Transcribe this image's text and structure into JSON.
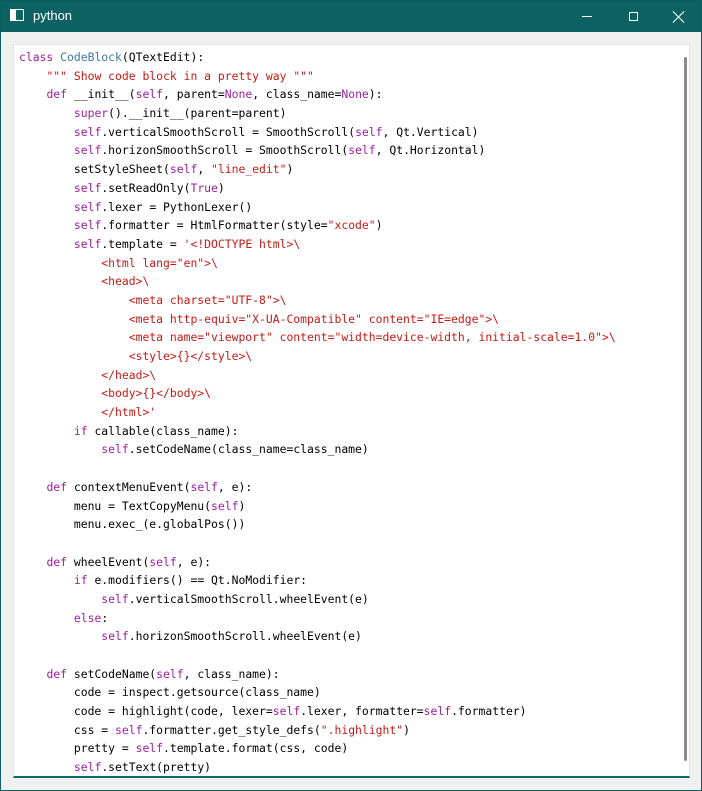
{
  "window": {
    "title": "python",
    "minimize_label": "minimize",
    "maximize_label": "maximize",
    "close_label": "close"
  },
  "colors": {
    "keyword": "#9c1fa0",
    "builtin": "#9c1fa0",
    "string": "#c41a16",
    "tag": "#c41a16",
    "classname": "#3c7a9e",
    "plain": "#000000",
    "titlebar": "#0c6262"
  },
  "code_lines": [
    [
      [
        "k",
        "class"
      ],
      [
        "p",
        " "
      ],
      [
        "c",
        "CodeBlock"
      ],
      [
        "p",
        "(QTextEdit):"
      ]
    ],
    [
      [
        "p",
        "    "
      ],
      [
        "s",
        "\"\"\" Show code block in a pretty way \"\"\""
      ]
    ],
    [
      [
        "p",
        "    "
      ],
      [
        "k",
        "def"
      ],
      [
        "p",
        " __init__("
      ],
      [
        "b",
        "self"
      ],
      [
        "p",
        ", parent="
      ],
      [
        "b",
        "None"
      ],
      [
        "p",
        ", class_name="
      ],
      [
        "b",
        "None"
      ],
      [
        "p",
        "):"
      ]
    ],
    [
      [
        "p",
        "        "
      ],
      [
        "b",
        "super"
      ],
      [
        "p",
        "().__init__(parent=parent)"
      ]
    ],
    [
      [
        "p",
        "        "
      ],
      [
        "b",
        "self"
      ],
      [
        "p",
        ".verticalSmoothScroll = SmoothScroll("
      ],
      [
        "b",
        "self"
      ],
      [
        "p",
        ", Qt.Vertical)"
      ]
    ],
    [
      [
        "p",
        "        "
      ],
      [
        "b",
        "self"
      ],
      [
        "p",
        ".horizonSmoothScroll = SmoothScroll("
      ],
      [
        "b",
        "self"
      ],
      [
        "p",
        ", Qt.Horizontal)"
      ]
    ],
    [
      [
        "p",
        "        setStyleSheet("
      ],
      [
        "b",
        "self"
      ],
      [
        "p",
        ", "
      ],
      [
        "s",
        "\"line_edit\""
      ],
      [
        "p",
        ")"
      ]
    ],
    [
      [
        "p",
        "        "
      ],
      [
        "b",
        "self"
      ],
      [
        "p",
        ".setReadOnly("
      ],
      [
        "b",
        "True"
      ],
      [
        "p",
        ")"
      ]
    ],
    [
      [
        "p",
        "        "
      ],
      [
        "b",
        "self"
      ],
      [
        "p",
        ".lexer = PythonLexer()"
      ]
    ],
    [
      [
        "p",
        "        "
      ],
      [
        "b",
        "self"
      ],
      [
        "p",
        ".formatter = HtmlFormatter(style="
      ],
      [
        "s",
        "\"xcode\""
      ],
      [
        "p",
        ")"
      ]
    ],
    [
      [
        "p",
        "        "
      ],
      [
        "b",
        "self"
      ],
      [
        "p",
        ".template = "
      ],
      [
        "s",
        "'<!DOCTYPE html>\\"
      ]
    ],
    [
      [
        "s",
        "            <html lang=\"en\">\\"
      ]
    ],
    [
      [
        "s",
        "            <head>\\"
      ]
    ],
    [
      [
        "s",
        "                <meta charset=\"UTF-8\">\\"
      ]
    ],
    [
      [
        "s",
        "                <meta http-equiv=\"X-UA-Compatible\" content=\"IE=edge\">\\"
      ]
    ],
    [
      [
        "s",
        "                <meta name=\"viewport\" content=\"width=device-width, initial-scale=1.0\">\\"
      ]
    ],
    [
      [
        "s",
        "                <style>{}</style>\\"
      ]
    ],
    [
      [
        "s",
        "            </head>\\"
      ]
    ],
    [
      [
        "s",
        "            <body>{}</body>\\"
      ]
    ],
    [
      [
        "s",
        "            </html>'"
      ]
    ],
    [
      [
        "p",
        "        "
      ],
      [
        "k",
        "if"
      ],
      [
        "p",
        " callable(class_name):"
      ]
    ],
    [
      [
        "p",
        "            "
      ],
      [
        "b",
        "self"
      ],
      [
        "p",
        ".setCodeName(class_name=class_name)"
      ]
    ],
    [
      [
        "p",
        ""
      ]
    ],
    [
      [
        "p",
        "    "
      ],
      [
        "k",
        "def"
      ],
      [
        "p",
        " contextMenuEvent("
      ],
      [
        "b",
        "self"
      ],
      [
        "p",
        ", e):"
      ]
    ],
    [
      [
        "p",
        "        menu = TextCopyMenu("
      ],
      [
        "b",
        "self"
      ],
      [
        "p",
        ")"
      ]
    ],
    [
      [
        "p",
        "        menu.exec_(e.globalPos())"
      ]
    ],
    [
      [
        "p",
        ""
      ]
    ],
    [
      [
        "p",
        "    "
      ],
      [
        "k",
        "def"
      ],
      [
        "p",
        " wheelEvent("
      ],
      [
        "b",
        "self"
      ],
      [
        "p",
        ", e):"
      ]
    ],
    [
      [
        "p",
        "        "
      ],
      [
        "k",
        "if"
      ],
      [
        "p",
        " e.modifiers() == Qt.NoModifier:"
      ]
    ],
    [
      [
        "p",
        "            "
      ],
      [
        "b",
        "self"
      ],
      [
        "p",
        ".verticalSmoothScroll.wheelEvent(e)"
      ]
    ],
    [
      [
        "p",
        "        "
      ],
      [
        "k",
        "else"
      ],
      [
        "p",
        ":"
      ]
    ],
    [
      [
        "p",
        "            "
      ],
      [
        "b",
        "self"
      ],
      [
        "p",
        ".horizonSmoothScroll.wheelEvent(e)"
      ]
    ],
    [
      [
        "p",
        ""
      ]
    ],
    [
      [
        "p",
        "    "
      ],
      [
        "k",
        "def"
      ],
      [
        "p",
        " setCodeName("
      ],
      [
        "b",
        "self"
      ],
      [
        "p",
        ", class_name):"
      ]
    ],
    [
      [
        "p",
        "        code = inspect.getsource(class_name)"
      ]
    ],
    [
      [
        "p",
        "        code = highlight(code, lexer="
      ],
      [
        "b",
        "self"
      ],
      [
        "p",
        ".lexer, formatter="
      ],
      [
        "b",
        "self"
      ],
      [
        "p",
        ".formatter)"
      ]
    ],
    [
      [
        "p",
        "        css = "
      ],
      [
        "b",
        "self"
      ],
      [
        "p",
        ".formatter.get_style_defs("
      ],
      [
        "s",
        "\".highlight\""
      ],
      [
        "p",
        ")"
      ]
    ],
    [
      [
        "p",
        "        pretty = "
      ],
      [
        "b",
        "self"
      ],
      [
        "p",
        ".template.format(css, code)"
      ]
    ],
    [
      [
        "p",
        "        "
      ],
      [
        "b",
        "self"
      ],
      [
        "p",
        ".setText(pretty)"
      ]
    ]
  ]
}
